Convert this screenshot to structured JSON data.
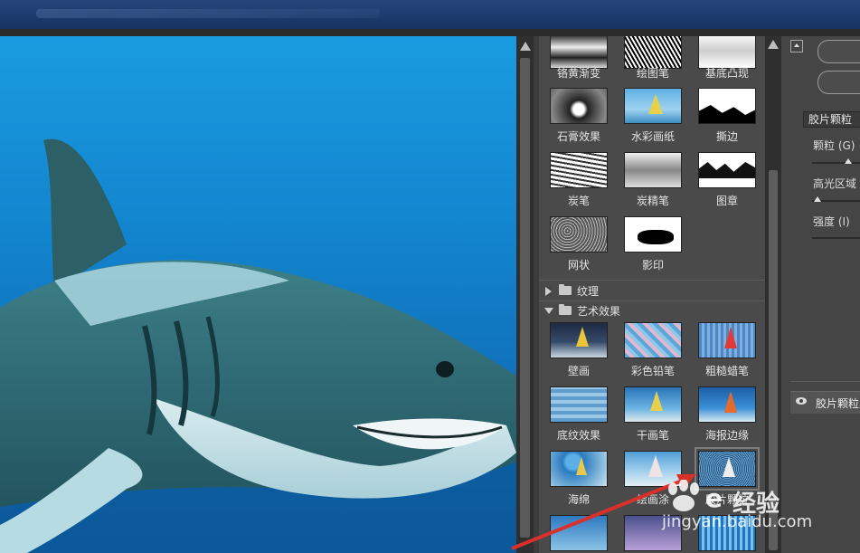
{
  "window": {
    "title": ""
  },
  "gallery": {
    "sketch_items": [
      {
        "label": "铬黄渐变",
        "icon": "chrome-thumbnail"
      },
      {
        "label": "绘图笔",
        "icon": "graphic-pen-thumbnail"
      },
      {
        "label": "基底凸现",
        "icon": "bas-relief-thumbnail"
      },
      {
        "label": "石膏效果",
        "icon": "plaster-thumbnail"
      },
      {
        "label": "水彩画纸",
        "icon": "note-paper-thumbnail"
      },
      {
        "label": "撕边",
        "icon": "torn-edges-thumbnail"
      },
      {
        "label": "炭笔",
        "icon": "charcoal-thumbnail"
      },
      {
        "label": "炭精笔",
        "icon": "conte-crayon-thumbnail"
      },
      {
        "label": "图章",
        "icon": "stamp-thumbnail"
      },
      {
        "label": "网状",
        "icon": "reticulation-thumbnail"
      },
      {
        "label": "影印",
        "icon": "photocopy-thumbnail"
      }
    ],
    "folder_texture": "纹理",
    "folder_artistic": "艺术效果",
    "artistic_items": [
      {
        "label": "壁画",
        "icon": "fresco-thumbnail"
      },
      {
        "label": "彩色铅笔",
        "icon": "colored-pencil-thumbnail"
      },
      {
        "label": "粗糙蜡笔",
        "icon": "rough-pastels-thumbnail"
      },
      {
        "label": "底纹效果",
        "icon": "underpainting-thumbnail"
      },
      {
        "label": "干画笔",
        "icon": "dry-brush-thumbnail"
      },
      {
        "label": "海报边缘",
        "icon": "poster-edges-thumbnail"
      },
      {
        "label": "海绵",
        "icon": "sponge-thumbnail"
      },
      {
        "label": "绘画涂",
        "icon": "paint-daubs-thumbnail"
      },
      {
        "label": "胶片颗粒",
        "icon": "film-grain-thumbnail"
      }
    ]
  },
  "filter_settings": {
    "selected_filter": "胶片颗粒",
    "grain_label": "颗粒 (G)",
    "grain_value": 0.66,
    "highlight_label": "高光区域",
    "highlight_value": 0.1,
    "intensity_label": "强度 (I)"
  },
  "effect_layer": {
    "label": "胶片颗粒"
  },
  "watermark": {
    "text": "经验",
    "url": "jingyan.baidu.com"
  },
  "colors": {
    "selection_arrow": "#d9302c",
    "panel_bg": "#4a4a4a"
  }
}
